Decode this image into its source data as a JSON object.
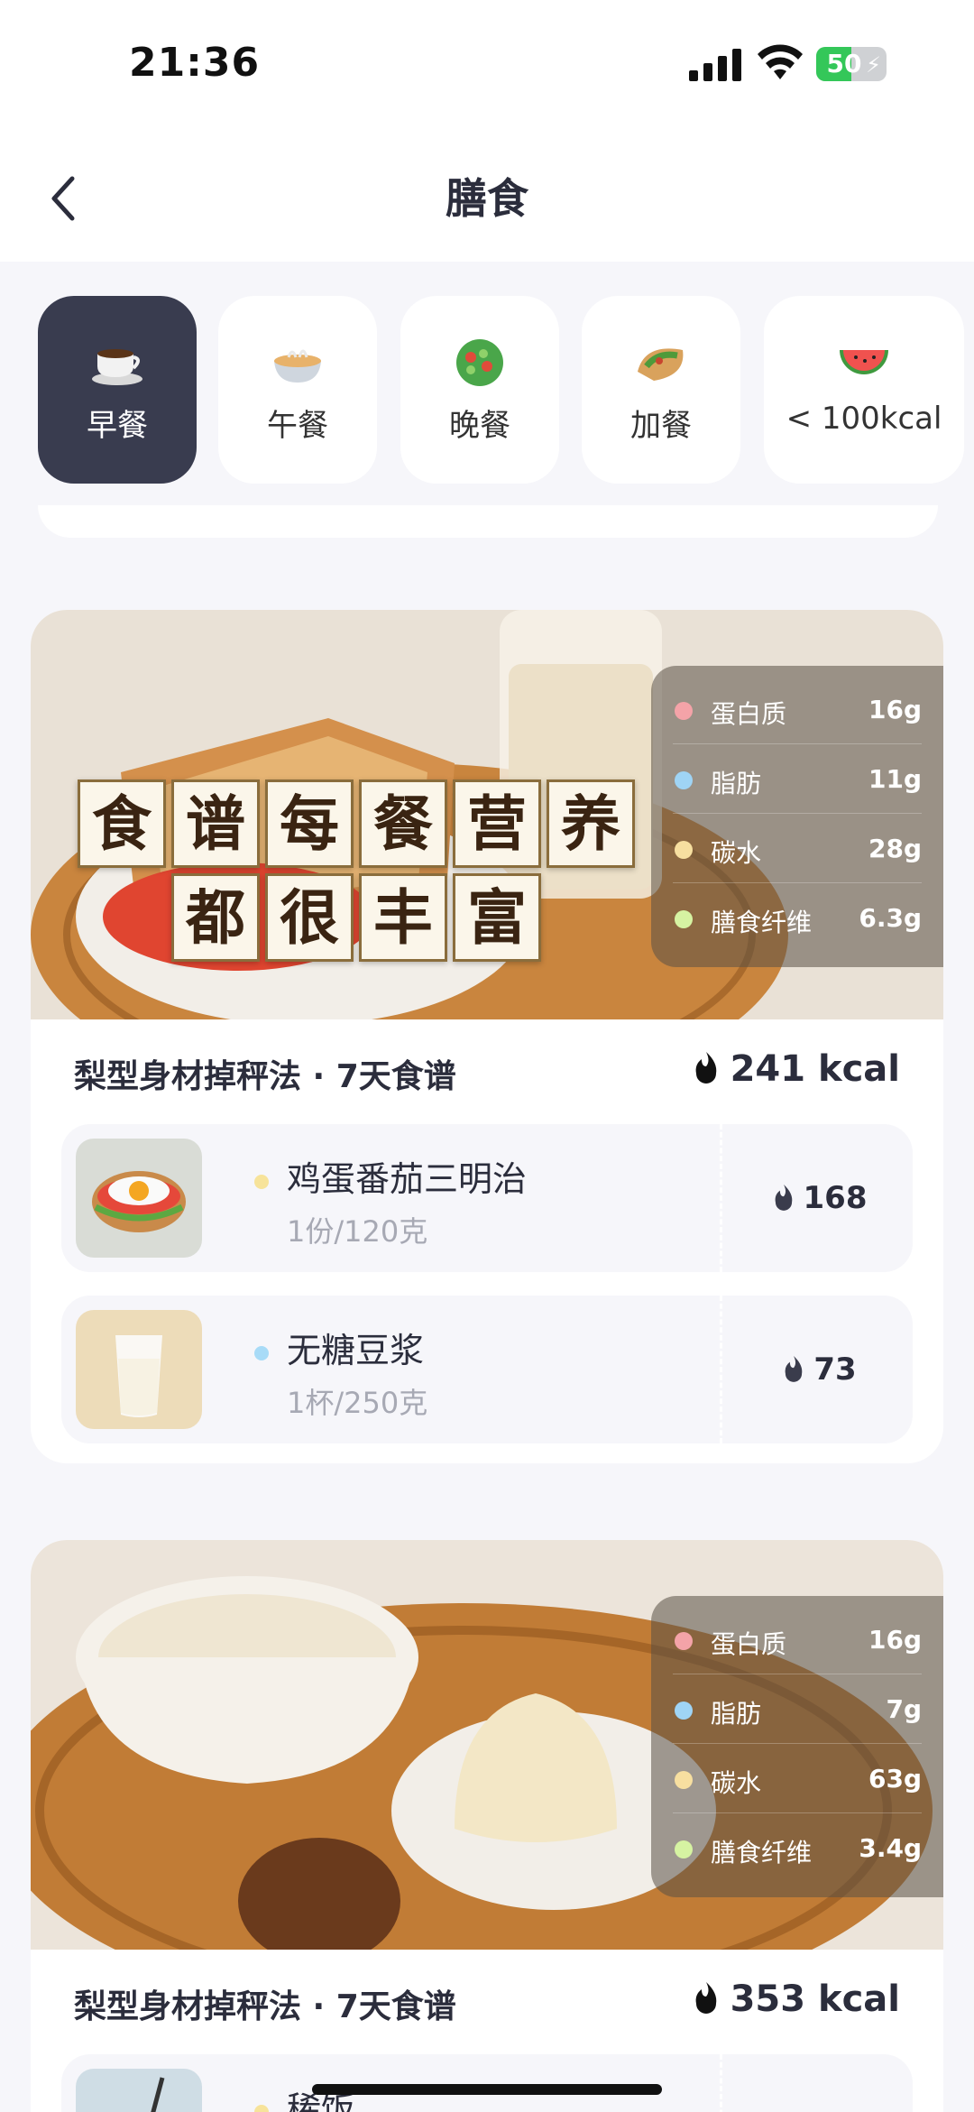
{
  "status_bar": {
    "time": "21:36",
    "battery": "50"
  },
  "nav": {
    "title": "膳食"
  },
  "tabs": [
    {
      "label": "早餐",
      "icon": "coffee-cup-icon",
      "active": true
    },
    {
      "label": "午餐",
      "icon": "noodle-bowl-icon",
      "active": false
    },
    {
      "label": "晚餐",
      "icon": "salad-icon",
      "active": false
    },
    {
      "label": "加餐",
      "icon": "stuffed-flatbread-icon",
      "active": false
    },
    {
      "label": "< 100kcal",
      "icon": "watermelon-icon",
      "active": false
    }
  ],
  "banner": {
    "line1": [
      "食",
      "谱",
      "每",
      "餐",
      "营",
      "养"
    ],
    "line2": [
      "都",
      "很",
      "丰",
      "富"
    ]
  },
  "cards": [
    {
      "title": "梨型身材掉秤法 · 7天食谱",
      "kcal": "241 kcal",
      "nutrition": [
        {
          "name": "蛋白质",
          "value": "16g",
          "color": "#f4a3a8"
        },
        {
          "name": "脂肪",
          "value": "11g",
          "color": "#9fd4f5"
        },
        {
          "name": "碳水",
          "value": "28g",
          "color": "#f7dfa0"
        },
        {
          "name": "膳食纤维",
          "value": "6.3g",
          "color": "#d6f3a2"
        }
      ],
      "items": [
        {
          "name": "鸡蛋番茄三明治",
          "portion": "1份/120克",
          "kcal": "168",
          "dot": "#f7e39a"
        },
        {
          "name": "无糖豆浆",
          "portion": "1杯/250克",
          "kcal": "73",
          "dot": "#a8dbf7"
        }
      ]
    },
    {
      "title": "梨型身材掉秤法 · 7天食谱",
      "kcal": "353 kcal",
      "nutrition": [
        {
          "name": "蛋白质",
          "value": "16g",
          "color": "#f4a3a8"
        },
        {
          "name": "脂肪",
          "value": "7g",
          "color": "#9fd4f5"
        },
        {
          "name": "碳水",
          "value": "63g",
          "color": "#f7dfa0"
        },
        {
          "name": "膳食纤维",
          "value": "3.4g",
          "color": "#d6f3a2"
        }
      ],
      "items": [
        {
          "name": "稀饭",
          "dot": "#f7e39a"
        }
      ]
    }
  ]
}
